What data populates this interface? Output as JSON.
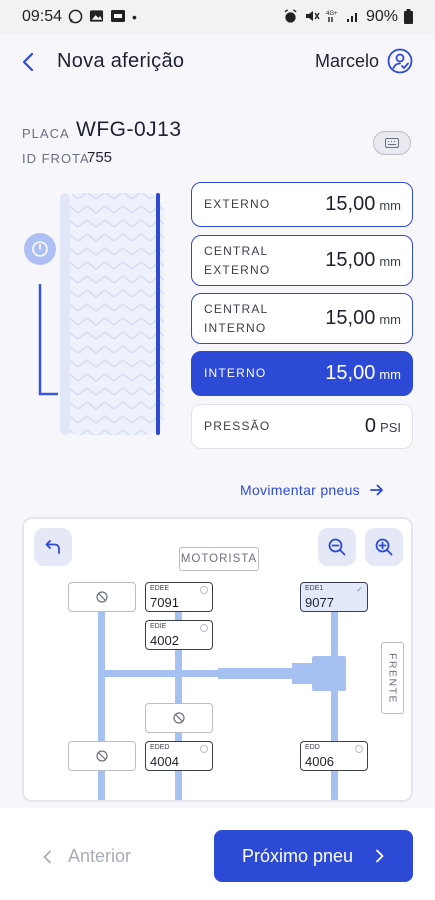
{
  "status_bar": {
    "time": "09:54",
    "battery": "90%"
  },
  "header": {
    "title": "Nova aferição",
    "user_name": "Marcelo"
  },
  "vehicle": {
    "placa_label": "PLACA",
    "placa": "WFG-0J13",
    "frota_label": "ID FROTA",
    "frota": "755"
  },
  "measurements": [
    {
      "label": "EXTERNO",
      "value": "15,00",
      "unit": "mm",
      "active": false
    },
    {
      "label": "CENTRAL\nEXTERNO",
      "value": "15,00",
      "unit": "mm",
      "active": false
    },
    {
      "label": "CENTRAL\nINTERNO",
      "value": "15,00",
      "unit": "mm",
      "active": false
    },
    {
      "label": "INTERNO",
      "value": "15,00",
      "unit": "mm",
      "active": true
    }
  ],
  "pressure": {
    "label": "PRESSÃO",
    "value": "0",
    "unit": "PSI"
  },
  "move_link": "Movimentar pneus",
  "diagram": {
    "motorista": "MOTORISTA",
    "frente": "FRENTE",
    "tires": [
      {
        "pos": "EDEE",
        "num": "7091",
        "selected": false
      },
      {
        "pos": "EDIE",
        "num": "4002",
        "selected": false
      },
      {
        "pos": "EDE1",
        "num": "9077",
        "selected": true
      },
      {
        "pos": "EDED",
        "num": "4004",
        "selected": false
      },
      {
        "pos": "EDD",
        "num": "4006",
        "selected": false
      }
    ]
  },
  "nav": {
    "prev": "Anterior",
    "next": "Próximo pneu"
  },
  "colors": {
    "primary": "#2d4ad6",
    "primary_light": "#aebff5",
    "axle": "#a6c0f2",
    "background": "#f7f7fb"
  }
}
